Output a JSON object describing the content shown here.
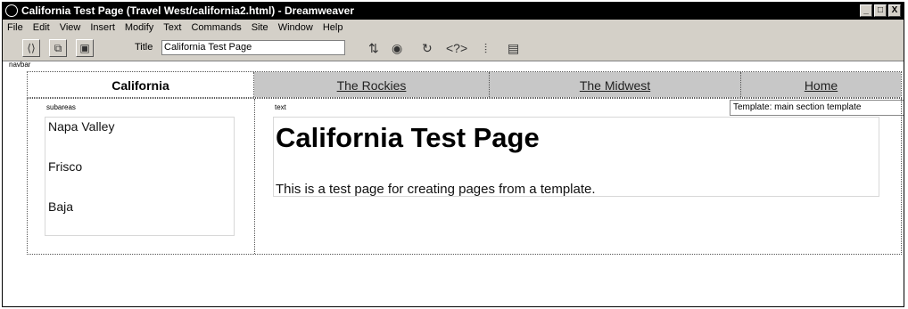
{
  "window": {
    "title": "California Test Page (Travel West/california2.html) - Dreamweaver",
    "controls": [
      "_",
      "□",
      "X"
    ]
  },
  "menu": [
    "File",
    "Edit",
    "View",
    "Insert",
    "Modify",
    "Text",
    "Commands",
    "Site",
    "Window",
    "Help"
  ],
  "toolbar": {
    "title_label": "Title",
    "title_value": "California Test Page",
    "icons": [
      "show-code-view-icon",
      "show-code-and-design-icon",
      "show-design-view-icon",
      "file-management-icon",
      "preview-in-browser-icon",
      "refresh-icon",
      "code-navigation-icon",
      "view-options-icon",
      "toolbar-options-icon"
    ]
  },
  "document": {
    "navbar_label": "navbar",
    "tooltip": "Template: main section template",
    "nav": [
      "California",
      "The Rockies",
      "The Midwest",
      "Home"
    ],
    "subareas_label": "subareas",
    "subareas": [
      "Napa Valley",
      "Frisco",
      "Baja"
    ],
    "text_label": "text",
    "heading": "California Test Page",
    "body": "This is a test page for creating pages from a template."
  }
}
